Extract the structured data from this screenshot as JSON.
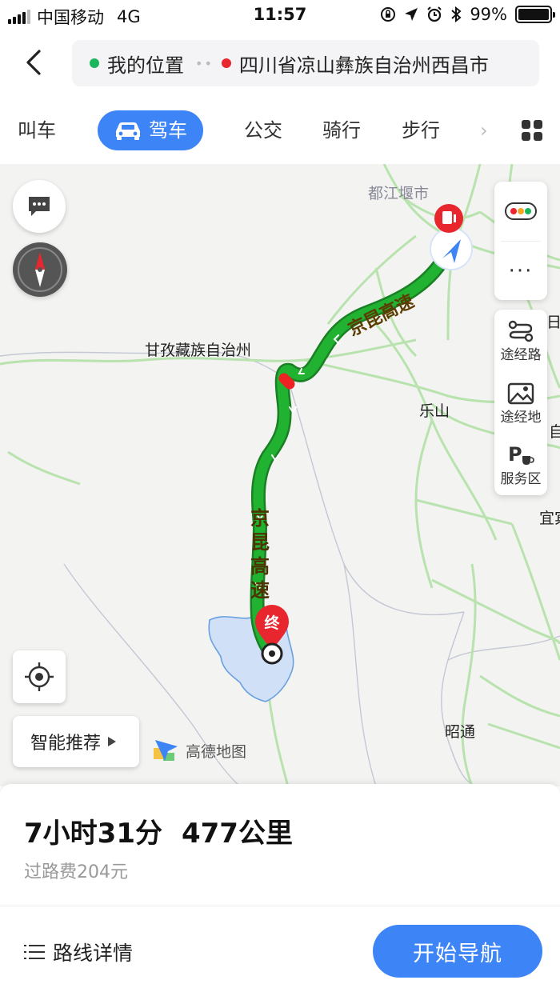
{
  "status_bar": {
    "carrier": "中国移动",
    "network": "4G",
    "time": "11:57",
    "battery": "99%",
    "battery_level": 0.99
  },
  "header": {
    "origin": "我的位置",
    "destination": "四川省凉山彝族自治州西昌市"
  },
  "modes": {
    "items": [
      "叫车",
      "驾车",
      "公交",
      "骑行",
      "步行"
    ],
    "active": "驾车"
  },
  "map": {
    "labels": {
      "dujiangyan": "都江堰市",
      "ganzi": "甘孜藏族自治州",
      "leshan": "乐山",
      "zhaotong": "昭通",
      "edge_ri": "日",
      "edge_zi": "自",
      "edge_yibin": "宜宾"
    },
    "road_name": "京昆高速",
    "end_marker": "终",
    "side_panel": {
      "waypoint": "途经路",
      "via_place": "途经地",
      "service_area": "服务区"
    },
    "recommend": "智能推荐",
    "brand": "高德地图",
    "route_color": "#22b232",
    "highlight_color": "#3d84f6"
  },
  "summary": {
    "duration": "7小时31分",
    "distance": "477公里",
    "toll": "过路费204元"
  },
  "actions": {
    "details": "路线详情",
    "start": "开始导航"
  }
}
